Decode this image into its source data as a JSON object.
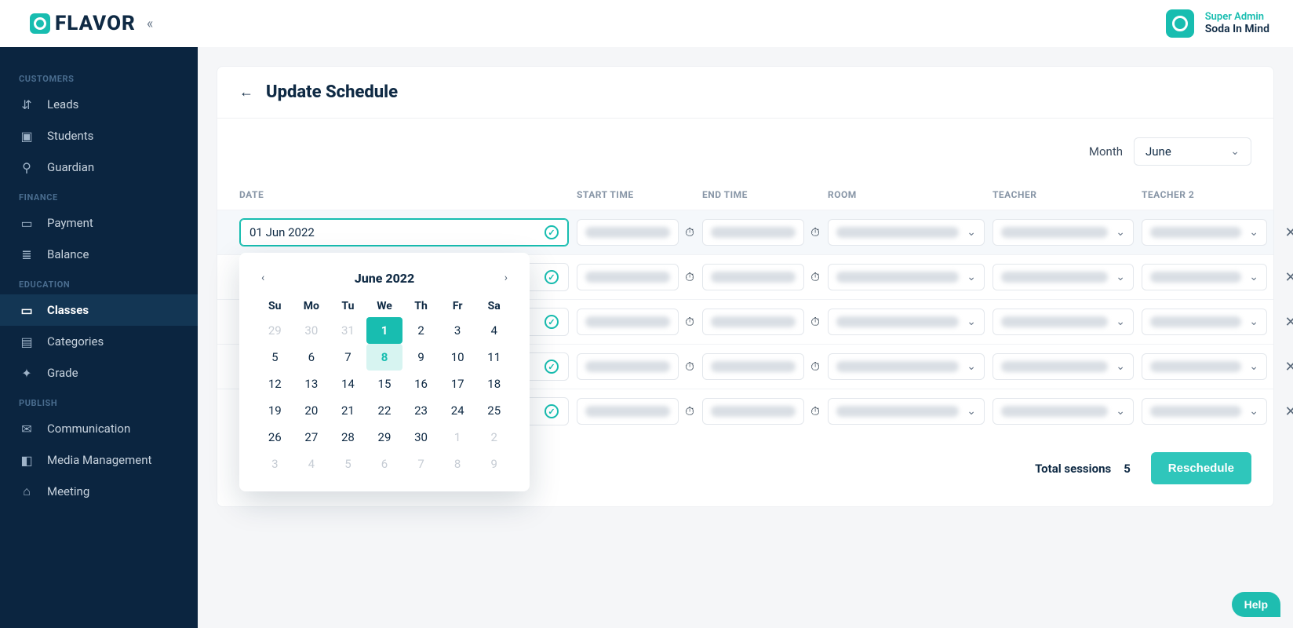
{
  "brand": {
    "name": "FLAVOR"
  },
  "user": {
    "role": "Super Admin",
    "name": "Soda In Mind"
  },
  "sidebar": {
    "sections": [
      {
        "label": "CUSTOMERS",
        "items": [
          {
            "label": "Leads",
            "icon": "leads-icon"
          },
          {
            "label": "Students",
            "icon": "students-icon"
          },
          {
            "label": "Guardian",
            "icon": "guardian-icon"
          }
        ]
      },
      {
        "label": "FINANCE",
        "items": [
          {
            "label": "Payment",
            "icon": "payment-icon"
          },
          {
            "label": "Balance",
            "icon": "balance-icon"
          }
        ]
      },
      {
        "label": "EDUCATION",
        "items": [
          {
            "label": "Classes",
            "icon": "classes-icon",
            "active": true
          },
          {
            "label": "Categories",
            "icon": "categories-icon"
          },
          {
            "label": "Grade",
            "icon": "grade-icon"
          }
        ]
      },
      {
        "label": "PUBLISH",
        "items": [
          {
            "label": "Communication",
            "icon": "communication-icon"
          },
          {
            "label": "Media Management",
            "icon": "media-icon"
          },
          {
            "label": "Meeting",
            "icon": "meeting-icon"
          }
        ]
      }
    ]
  },
  "page": {
    "title": "Update Schedule",
    "filter": {
      "label": "Month",
      "value": "June"
    },
    "table": {
      "headers": [
        "DATE",
        "START TIME",
        "END TIME",
        "ROOM",
        "TEACHER",
        "TEACHER 2"
      ],
      "rows": [
        {
          "date": "01 Jun 2022",
          "active": true
        },
        {
          "date": "",
          "active": false
        },
        {
          "date": "",
          "active": false
        },
        {
          "date": "",
          "active": false
        },
        {
          "date": "",
          "active": false
        }
      ]
    },
    "footer": {
      "total_label": "Total sessions",
      "total_value": "5",
      "action_label": "Reschedule"
    }
  },
  "datepicker": {
    "title": "June 2022",
    "dow": [
      "Su",
      "Mo",
      "Tu",
      "We",
      "Th",
      "Fr",
      "Sa"
    ],
    "weeks": [
      [
        {
          "d": "29",
          "muted": true
        },
        {
          "d": "30",
          "muted": true
        },
        {
          "d": "31",
          "muted": true
        },
        {
          "d": "1",
          "selected": true
        },
        {
          "d": "2"
        },
        {
          "d": "3"
        },
        {
          "d": "4"
        }
      ],
      [
        {
          "d": "5"
        },
        {
          "d": "6"
        },
        {
          "d": "7"
        },
        {
          "d": "8",
          "today": true
        },
        {
          "d": "9"
        },
        {
          "d": "10"
        },
        {
          "d": "11"
        }
      ],
      [
        {
          "d": "12"
        },
        {
          "d": "13"
        },
        {
          "d": "14"
        },
        {
          "d": "15"
        },
        {
          "d": "16"
        },
        {
          "d": "17"
        },
        {
          "d": "18"
        }
      ],
      [
        {
          "d": "19"
        },
        {
          "d": "20"
        },
        {
          "d": "21"
        },
        {
          "d": "22"
        },
        {
          "d": "23"
        },
        {
          "d": "24"
        },
        {
          "d": "25"
        }
      ],
      [
        {
          "d": "26"
        },
        {
          "d": "27"
        },
        {
          "d": "28"
        },
        {
          "d": "29"
        },
        {
          "d": "30"
        },
        {
          "d": "1",
          "muted": true
        },
        {
          "d": "2",
          "muted": true
        }
      ],
      [
        {
          "d": "3",
          "muted": true
        },
        {
          "d": "4",
          "muted": true
        },
        {
          "d": "5",
          "muted": true
        },
        {
          "d": "6",
          "muted": true
        },
        {
          "d": "7",
          "muted": true
        },
        {
          "d": "8",
          "muted": true
        },
        {
          "d": "9",
          "muted": true
        }
      ]
    ]
  },
  "help": {
    "label": "Help"
  }
}
